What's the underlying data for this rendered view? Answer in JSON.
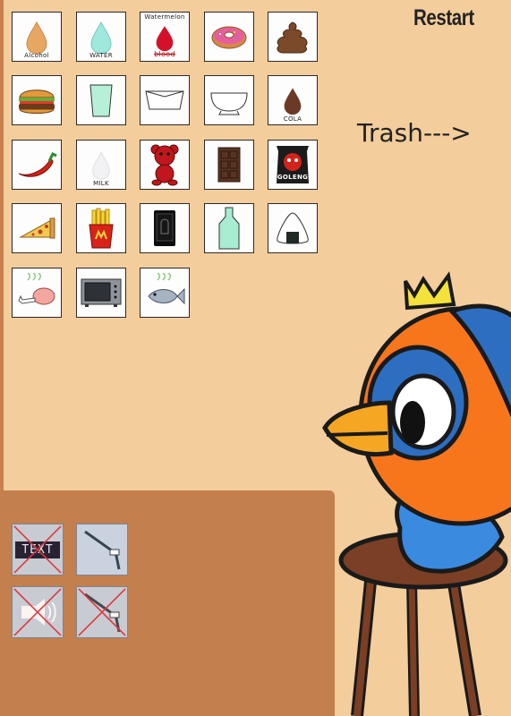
{
  "game": {
    "restart_label": "Restart",
    "trash_label": "Trash--->"
  },
  "items": [
    {
      "name": "alcohol",
      "label": "Alcohol",
      "icon": "alcohol-drop-icon"
    },
    {
      "name": "water",
      "label": "WATER",
      "icon": "water-drop-icon"
    },
    {
      "name": "watermelon",
      "label": "Watermelon",
      "sublabel": "blood",
      "icon": "red-drop-icon"
    },
    {
      "name": "donut",
      "label": "",
      "icon": "donut-icon"
    },
    {
      "name": "poop",
      "label": "",
      "icon": "poop-icon"
    },
    {
      "name": "burger",
      "label": "",
      "icon": "burger-icon"
    },
    {
      "name": "glass",
      "label": "",
      "icon": "glass-icon"
    },
    {
      "name": "tray",
      "label": "",
      "icon": "tray-icon"
    },
    {
      "name": "bowl",
      "label": "",
      "icon": "bowl-icon"
    },
    {
      "name": "cola",
      "label": "COLA",
      "icon": "cola-drop-icon"
    },
    {
      "name": "chili",
      "label": "",
      "icon": "chili-pepper-icon"
    },
    {
      "name": "milk",
      "label": "MILK",
      "icon": "milk-drop-icon"
    },
    {
      "name": "teddy-bear",
      "label": "",
      "icon": "teddy-bear-icon"
    },
    {
      "name": "chocolate",
      "label": "",
      "icon": "chocolate-bar-icon"
    },
    {
      "name": "chips",
      "label": "GOLENG",
      "icon": "chips-bag-icon"
    },
    {
      "name": "pizza",
      "label": "",
      "icon": "pizza-slice-icon"
    },
    {
      "name": "fries",
      "label": "",
      "icon": "fries-icon"
    },
    {
      "name": "phone",
      "label": "",
      "icon": "phone-icon"
    },
    {
      "name": "bottle",
      "label": "",
      "icon": "bottle-icon"
    },
    {
      "name": "onigiri",
      "label": "",
      "icon": "onigiri-icon"
    },
    {
      "name": "drumstick",
      "label": "",
      "icon": "chicken-leg-icon"
    },
    {
      "name": "microwave",
      "label": "",
      "icon": "microwave-icon"
    },
    {
      "name": "fish",
      "label": "",
      "icon": "fish-icon"
    }
  ],
  "controls": {
    "text_chip": "TEXT",
    "text_toggle_icon": "text-off-icon",
    "lamp_icon": "desk-lamp-icon",
    "sound_icon": "sound-off-icon",
    "lamp_off_icon": "desk-lamp-off-icon"
  },
  "colors": {
    "background": "#f3cd9c",
    "panel": "#c37f4d",
    "bird_body": "#f7761c",
    "bird_blue": "#2d6ec0",
    "beak": "#f5a623",
    "crown": "#f2e23a",
    "stool": "#7a3f24"
  }
}
